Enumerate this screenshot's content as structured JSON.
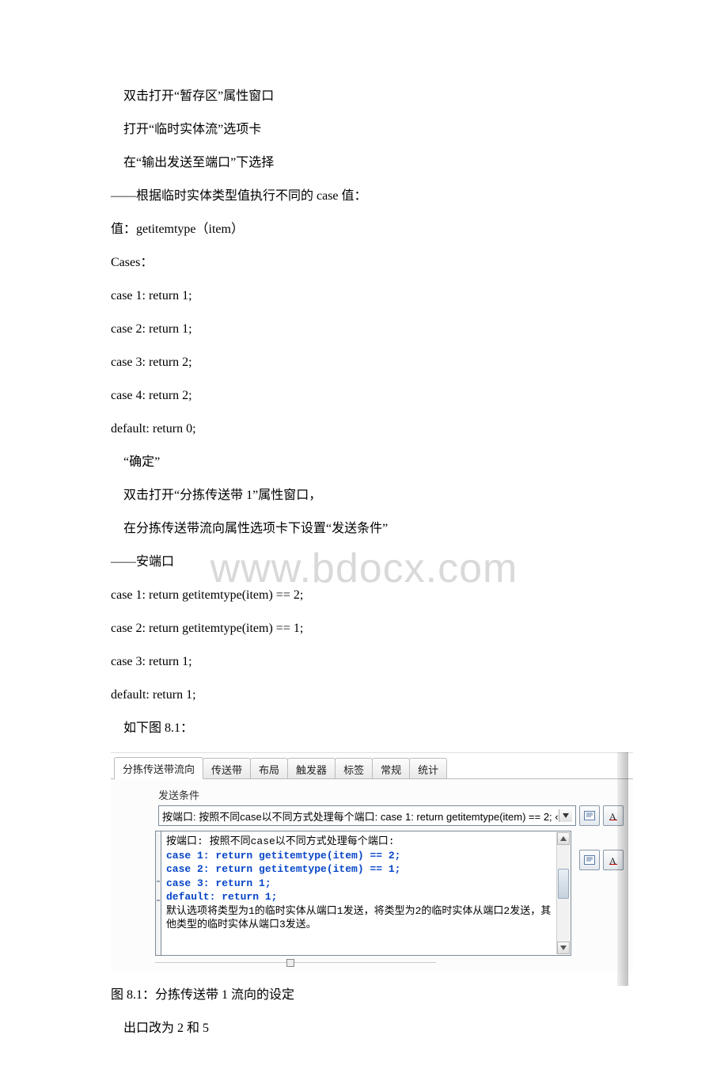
{
  "watermark": "www.bdocx.com",
  "body": {
    "p1": "　双击打开“暂存区”属性窗口",
    "p2": "　打开“临时实体流”选项卡",
    "p3": "　在“输出发送至端口”下选择",
    "p4": "——根据临时实体类型值执行不同的 case 值：",
    "p5": "值：getitemtype（item）",
    "p6": "Cases：",
    "p7": "case 1: return 1;",
    "p8": "case 2: return 1;",
    "p9": "case 3: return 2;",
    "p10": "case 4: return 2;",
    "p11": "default: return 0;",
    "p12": "　“确定”",
    "p13": "　双击打开“分拣传送带 1”属性窗口，",
    "p14": "　在分拣传送带流向属性选项卡下设置“发送条件”",
    "p15": "——安端口",
    "p16": "case 1: return getitemtype(item) == 2;",
    "p17": "case 2: return getitemtype(item) == 1;",
    "p18": "case 3: return 1;",
    "p19": "default: return 1;",
    "p20": "　如下图 8.1：",
    "caption": "图 8.1：分拣传送带 1 流向的设定",
    "p21": "　出口改为 2 和 5"
  },
  "figure": {
    "tabs": [
      "分拣传送带流向",
      "传送带",
      "布局",
      "触发器",
      "标签",
      "常规",
      "统计"
    ],
    "active_tab": 0,
    "section_label": "发送条件",
    "dropdown_value": "按端口: 按照不同case以不同方式处理每个端口:  case 1: return getitemtype(item) == 2;  ‹ ",
    "code_lines": [
      {
        "text": "按端口: 按照不同case以不同方式处理每个端口:",
        "kind": "desc"
      },
      {
        "text": "",
        "kind": "blank"
      },
      {
        "text": "",
        "kind": "blank"
      },
      {
        "text": "case 1: return getitemtype(item) == 2;",
        "kind": "code"
      },
      {
        "text": "case 2: return getitemtype(item) == 1;",
        "kind": "code"
      },
      {
        "text": "case 3: return 1;",
        "kind": "code"
      },
      {
        "text": "default: return 1;",
        "kind": "code"
      },
      {
        "text": "",
        "kind": "blank"
      },
      {
        "text": "默认选项将类型为1的临时实体从端口1发送，将类型为2的临时实体从端口2发送，其",
        "kind": "desc"
      },
      {
        "text": "他类型的临时实体从端口3发送。",
        "kind": "desc"
      }
    ]
  }
}
